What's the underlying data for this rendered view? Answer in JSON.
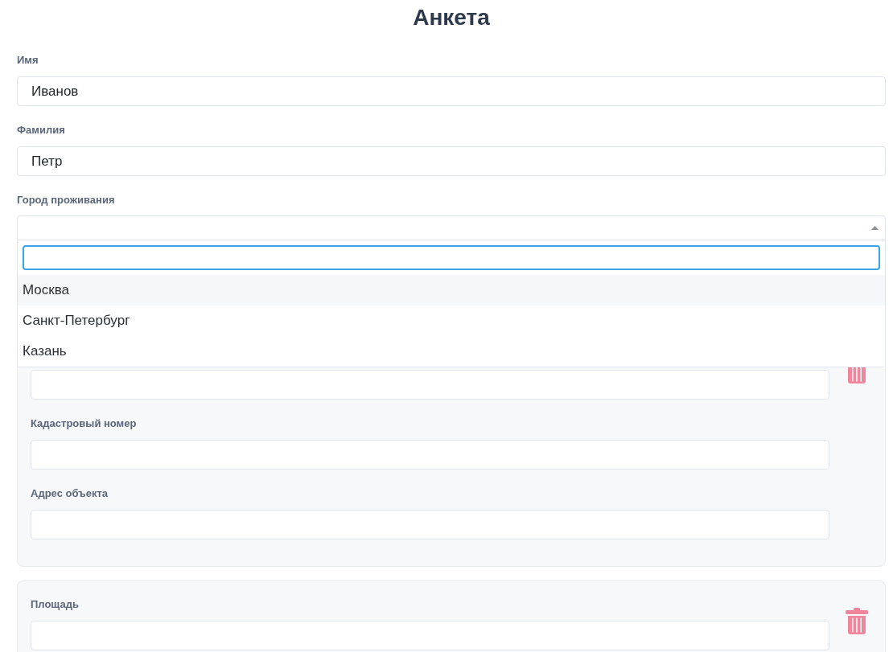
{
  "title": "Анкета",
  "fields": [
    {
      "kind": "input",
      "label": "Имя",
      "value": "Иванов"
    },
    {
      "kind": "input",
      "label": "Фамилия",
      "value": "Петр"
    }
  ],
  "city_select": {
    "label": "Город проживания",
    "expanded": true,
    "search": {
      "focused": true
    },
    "options": [
      {
        "label": "Москва",
        "highlighted": true
      },
      {
        "label": "Санкт-Петербург",
        "highlighted": false
      },
      {
        "label": "Казань",
        "highlighted": false
      }
    ]
  },
  "cards": [
    {
      "removable": true,
      "fields": [
        {
          "kind": "input"
        },
        {
          "kind": "input",
          "label": "Кадастровый номер"
        },
        {
          "kind": "input",
          "label": "Адрес объекта"
        }
      ]
    },
    {
      "removable": true,
      "fields": [
        {
          "kind": "input",
          "label": "Площадь"
        }
      ]
    }
  ]
}
